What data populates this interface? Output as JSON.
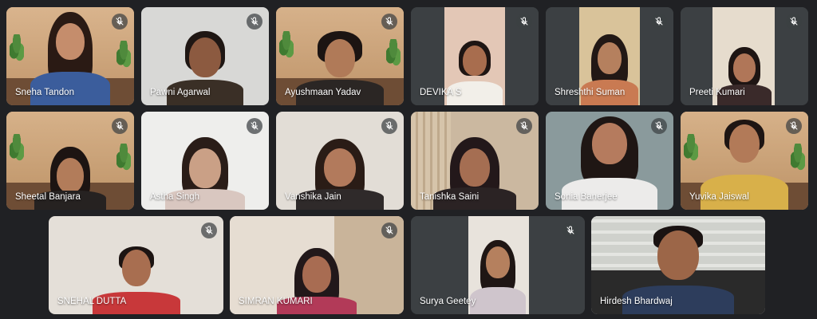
{
  "participants": [
    {
      "name": "Sneha Tandon",
      "muted": true
    },
    {
      "name": "Pawni Agarwal",
      "muted": true
    },
    {
      "name": "Ayushmaan Yadav",
      "muted": true
    },
    {
      "name": "DEVIKA S",
      "muted": true
    },
    {
      "name": "Shreshthi Suman",
      "muted": true
    },
    {
      "name": "Preeti Kumari",
      "muted": true
    },
    {
      "name": "Sheetal Banjara",
      "muted": true
    },
    {
      "name": "Astha Singh",
      "muted": true
    },
    {
      "name": "Vanshika Jain",
      "muted": true
    },
    {
      "name": "Tanishka Saini",
      "muted": true
    },
    {
      "name": "Sonia Banerjee",
      "muted": true
    },
    {
      "name": "Yuvika Jaiswal",
      "muted": true
    },
    {
      "name": "SNEHAL DUTTA",
      "muted": true
    },
    {
      "name": "SIMRAN KUMARI",
      "muted": true
    },
    {
      "name": "Surya Geetey",
      "muted": true
    },
    {
      "name": "Hirdesh Bhardwaj",
      "muted": false
    }
  ],
  "icons": {
    "mute": "mic-off-icon"
  },
  "colors": {
    "background": "#202124",
    "tile": "#3c4043",
    "name_text": "#ffffff"
  }
}
